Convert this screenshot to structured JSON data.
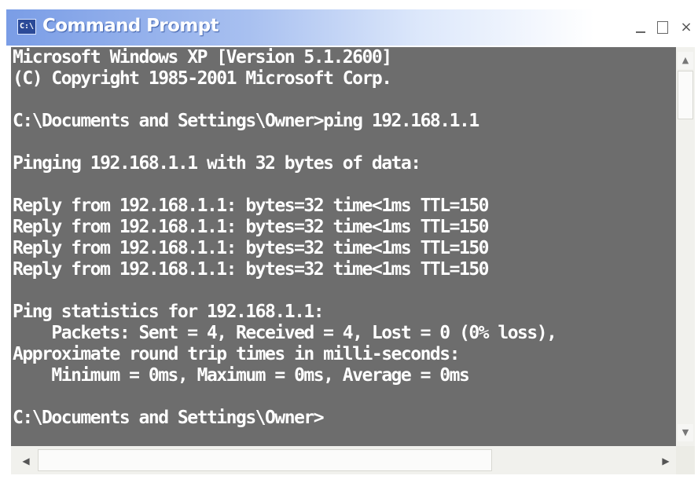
{
  "window": {
    "title": "Command Prompt",
    "icon_label": "C:\\",
    "buttons": {
      "minimize": "minimize-icon",
      "maximize": "maximize-icon",
      "close": "×"
    }
  },
  "console": {
    "background": "#6d6d6d",
    "foreground": "#ffffff",
    "lines": [
      "Microsoft Windows XP [Version 5.1.2600]",
      "(C) Copyright 1985-2001 Microsoft Corp.",
      "",
      "C:\\Documents and Settings\\Owner>ping 192.168.1.1",
      "",
      "Pinging 192.168.1.1 with 32 bytes of data:",
      "",
      "Reply from 192.168.1.1: bytes=32 time<1ms TTL=150",
      "Reply from 192.168.1.1: bytes=32 time<1ms TTL=150",
      "Reply from 192.168.1.1: bytes=32 time<1ms TTL=150",
      "Reply from 192.168.1.1: bytes=32 time<1ms TTL=150",
      "",
      "Ping statistics for 192.168.1.1:",
      "    Packets: Sent = 4, Received = 4, Lost = 0 (0% loss),",
      "Approximate round trip times in milli-seconds:",
      "    Minimum = 0ms, Maximum = 0ms, Average = 0ms",
      "",
      "C:\\Documents and Settings\\Owner>"
    ]
  },
  "scrollbars": {
    "up_arrow": "▲",
    "down_arrow": "▼",
    "left_arrow": "◀",
    "right_arrow": "▶"
  }
}
